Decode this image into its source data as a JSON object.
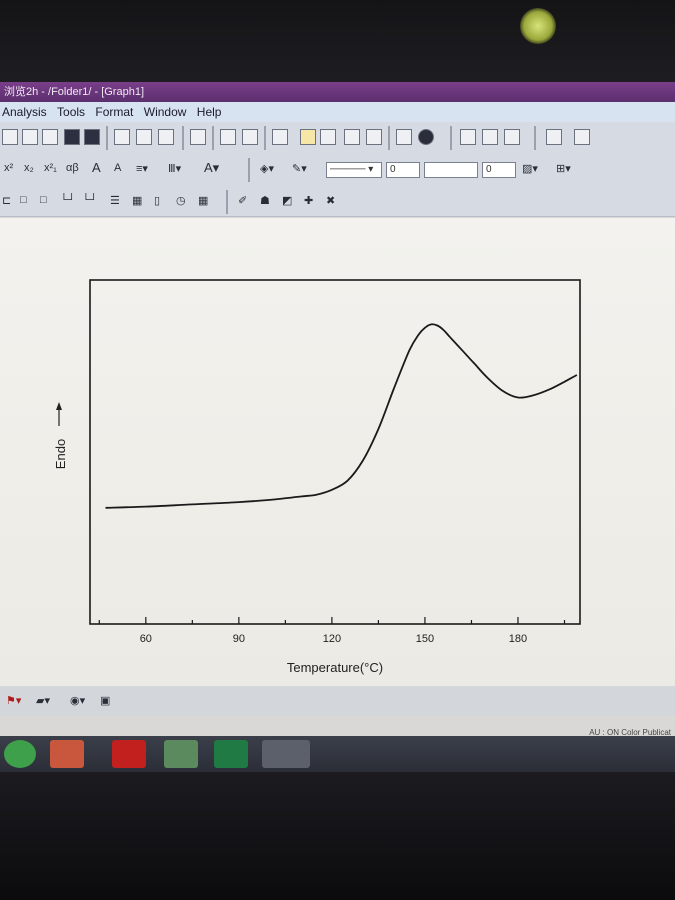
{
  "window": {
    "title": "浏览2h - /Folder1/ - [Graph1]"
  },
  "menu": {
    "items": [
      "Analysis",
      "Tools",
      "Format",
      "Window",
      "Help"
    ]
  },
  "toolbar": {
    "line_width_1": "0",
    "line_width_2": "0"
  },
  "status": {
    "text": "AU : ON  Color Publicat"
  },
  "chart_data": {
    "type": "line",
    "title": "",
    "xlabel": "Temperature(°C)",
    "ylabel": "Endo",
    "xlim": [
      42,
      200
    ],
    "ylim": [
      0,
      1
    ],
    "xticks": [
      60,
      90,
      120,
      150,
      180
    ],
    "x_tick_labels": [
      "60",
      "90",
      "120",
      "150",
      "180"
    ],
    "show_y_ticks": false,
    "grid": false,
    "legend": "none",
    "line_color": "#1a1a1a",
    "series": [
      {
        "x": [
          47,
          60,
          75,
          90,
          100,
          110,
          115,
          120,
          125,
          130,
          135,
          140,
          145,
          148,
          150,
          152,
          154,
          156,
          158,
          162,
          166,
          170,
          175,
          180,
          185,
          190,
          195,
          199
        ],
        "y": [
          0.21,
          0.215,
          0.225,
          0.235,
          0.245,
          0.26,
          0.268,
          0.29,
          0.33,
          0.42,
          0.56,
          0.74,
          0.91,
          0.98,
          1.01,
          1.025,
          1.02,
          1.0,
          0.97,
          0.91,
          0.85,
          0.79,
          0.73,
          0.7,
          0.71,
          0.735,
          0.77,
          0.8
        ]
      }
    ]
  }
}
